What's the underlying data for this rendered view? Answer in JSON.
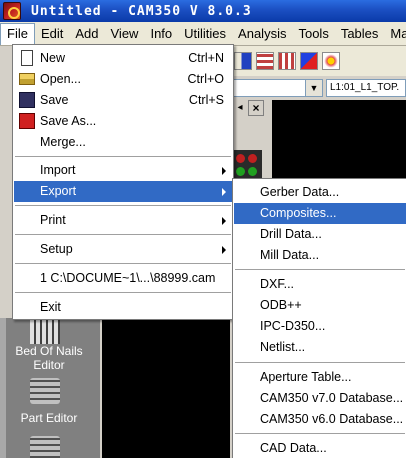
{
  "app": {
    "title": "Untitled - CAM350 V 8.0.3"
  },
  "menubar": [
    "File",
    "Edit",
    "Add",
    "View",
    "Info",
    "Utilities",
    "Analysis",
    "Tools",
    "Tables",
    "Mac"
  ],
  "layer_select": "L1:01_L1_TOP.",
  "file_menu": {
    "new": {
      "label": "New",
      "shortcut": "Ctrl+N"
    },
    "open": {
      "label": "Open...",
      "shortcut": "Ctrl+O"
    },
    "save": {
      "label": "Save",
      "shortcut": "Ctrl+S"
    },
    "save_as": "Save As...",
    "merge": "Merge...",
    "import": "Import",
    "export": "Export",
    "print": "Print",
    "setup": "Setup",
    "recent": "1 C:\\DOCUME~1\\...\\88999.cam",
    "exit": "Exit"
  },
  "export_menu": {
    "gerber": "Gerber Data...",
    "composites": "Composites...",
    "drill": "Drill Data...",
    "mill": "Mill Data...",
    "dxf": "DXF...",
    "odb": "ODB++",
    "ipc": "IPC-D350...",
    "netlist": "Netlist...",
    "aperture": "Aperture Table...",
    "cam7": "CAM350 v7.0 Database...",
    "cam6": "CAM350 v6.0 Database...",
    "cad": "CAD Data..."
  },
  "left_tools": {
    "bed_of_nails": "Bed Of Nails Editor",
    "part_editor": "Part Editor"
  },
  "colors": {
    "highlight": "#316ac5",
    "title_bar": "#0a3aa8",
    "menu_bg": "#ffffff"
  }
}
